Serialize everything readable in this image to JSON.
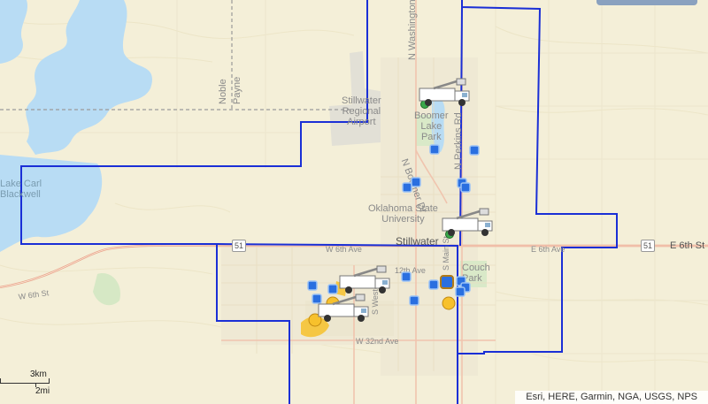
{
  "map": {
    "labels": {
      "noble": "Noble",
      "payne": "Payne",
      "n_washington": "N Washington",
      "airport": "Stillwater\nRegional\nAirport",
      "boomer_lake_park": "Boomer\nLake\nPark",
      "n_boomer_dr": "N Boomer Dr",
      "n_perkins_rd": "N Perkins Rd",
      "osu": "Oklahoma State\nUniversity",
      "stillwater": "Stillwater",
      "w_6th_ave": "W 6th Ave",
      "e_6th_ave": "E 6th Ave",
      "e_6th_st": "E 6th St",
      "w_6th_st": "W 6th St",
      "ave_12th": "12th Ave",
      "couch_park": "Couch\nPark",
      "w_32nd_ave": "W 32nd Ave",
      "s_western": "S Western",
      "s_main": "S Main St",
      "lake_carl_blackwell": "Lake Carl\nBlackwell"
    },
    "route_shields": [
      "51",
      "51"
    ],
    "scale": {
      "km": "3km",
      "mi": "2mi"
    },
    "attribution": "Esri, HERE, Garmin, NGA, USGS, NPS",
    "colors": {
      "land": "#f4efd8",
      "water": "#b8dcf4",
      "boundary": "#1a2fd6",
      "road": "#e6a48c",
      "urban": "#e9e4d2",
      "incident_blue": "#2a6fe0",
      "incident_yellow": "#f7c12c",
      "crew_green": "#3aa84a"
    },
    "icons": [
      "bucket-truck-icon",
      "outage-marker-icon",
      "outage-cluster-icon"
    ]
  }
}
